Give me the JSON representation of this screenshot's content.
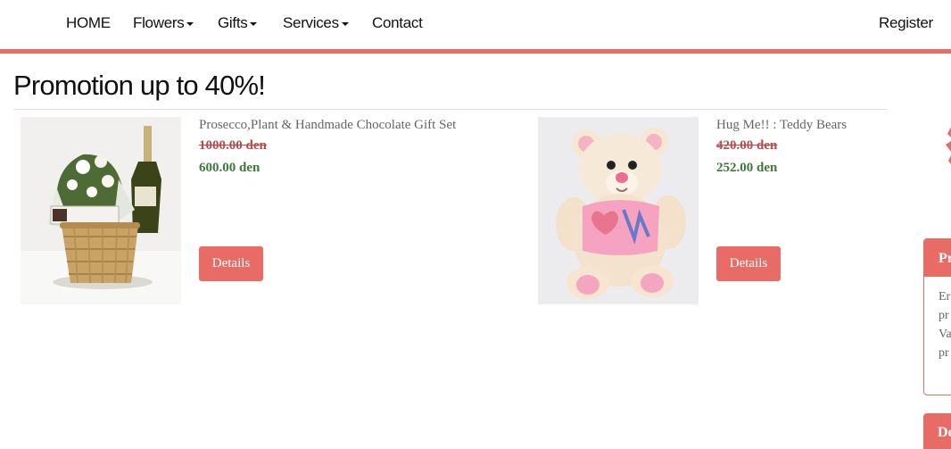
{
  "nav": {
    "home": "HOME",
    "flowers": "Flowers",
    "gifts": "Gifts",
    "services": "Services",
    "contact": "Contact",
    "register": "Register"
  },
  "page": {
    "title": "Promotion up to 40%!"
  },
  "products": [
    {
      "name": "Prosecco,Plant & Handmade Chocolate Gift Set",
      "old_price": "1000.00 den",
      "new_price": "600.00 den",
      "button": "Details",
      "image": "gift-basket-with-prosecco-and-plant"
    },
    {
      "name": "Hug Me!! : Teddy Bears",
      "old_price": "420.00 den",
      "new_price": "252.00 den",
      "button": "Details",
      "image": "cream-teddy-bear-in-pink-shirt"
    }
  ],
  "sidebar": {
    "panel1_title": "Pr",
    "panel1_lines": [
      "Er",
      "pr",
      "Va",
      "pr"
    ],
    "panel2_title": "De"
  },
  "colors": {
    "accent": "#e96b66",
    "old_price": "#b94a48",
    "new_price": "#3c7a3a",
    "text_muted": "#666666"
  }
}
